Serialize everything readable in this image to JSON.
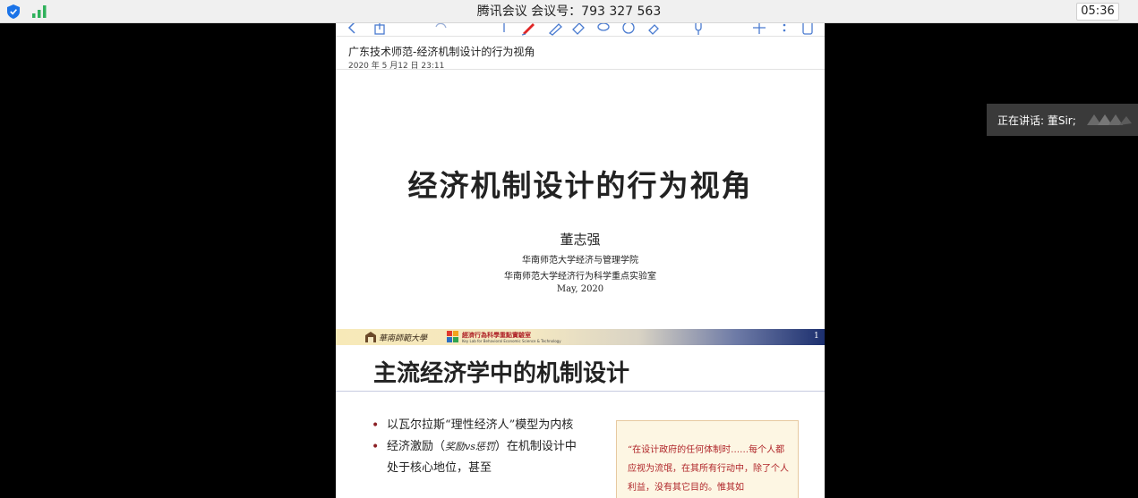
{
  "meeting": {
    "title": "腾讯会议 会议号：793 327 563",
    "timer": "05:36"
  },
  "icons": {
    "top_left": [
      "shield-icon",
      "signal-icon"
    ],
    "doc_toolbar": [
      "back-icon",
      "share-icon",
      "undo-icon",
      "pencil-icon",
      "pen-icon",
      "highlighter-icon",
      "eraser-icon",
      "lasso-icon",
      "shapes-icon",
      "hand-icon",
      "mic-icon",
      "add-icon",
      "more-icon",
      "pages-icon"
    ]
  },
  "document": {
    "title": "广东技术师范-经济机制设计的行为视角",
    "date": "2020 年 5 月12 日 23:11"
  },
  "slide1": {
    "title": "经济机制设计的行为视角",
    "author": "董志强",
    "affiliation_1": "华南师范大学经济与管理学院",
    "affiliation_2": "华南师范大学经济行为科学重点实验室",
    "date": "May, 2020",
    "footer": {
      "university_name": "華南師範大學",
      "lab_name": "經濟行為科學重點實驗室",
      "lab_subtitle": "Key Lab for Behavioral Economic Science & Technology",
      "page_number": "1"
    }
  },
  "slide2": {
    "title": "主流经济学中的机制设计",
    "bullet_1": "以瓦尔拉斯“理性经济人”模型为内核",
    "bullet_2_a": "经济激励（",
    "bullet_2_b": "奖励vs惩罚",
    "bullet_2_c": "）在机制设计中处于核心地位，甚至",
    "quote": "“在设计政府的任何体制时……每个人都应视为流氓，在其所有行动中，除了个人利益，没有其它目的。惟其如"
  },
  "speaker": {
    "label": "正在讲话: 董Sir;"
  },
  "colors": {
    "top_bar": "#f0f0f0",
    "shield": "#1a73e8",
    "signal": "#2fb15b",
    "toolbar_icon": "#4a7bd0",
    "bullet": "#8b1f24",
    "quote_text": "#b0262a",
    "footer_dark": "#1c2f6e"
  }
}
